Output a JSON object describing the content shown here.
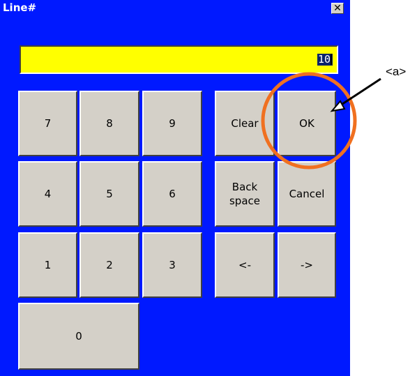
{
  "window": {
    "title": "Line#",
    "close_glyph": "✕"
  },
  "display": {
    "value": "10"
  },
  "keys": {
    "k7": "7",
    "k8": "8",
    "k9": "9",
    "k4": "4",
    "k5": "5",
    "k6": "6",
    "k1": "1",
    "k2": "2",
    "k3": "3",
    "k0": "0",
    "clear": "Clear",
    "ok": "OK",
    "backspace_line1": "Back",
    "backspace_line2": "space",
    "cancel": "Cancel",
    "left": "<-",
    "right": "->"
  },
  "annotation": {
    "label": "<a>"
  },
  "colors": {
    "window_bg": "#0019ff",
    "display_bg": "#ffff00",
    "key_face": "#d4d0c8",
    "highlight_circle": "#f07020"
  }
}
